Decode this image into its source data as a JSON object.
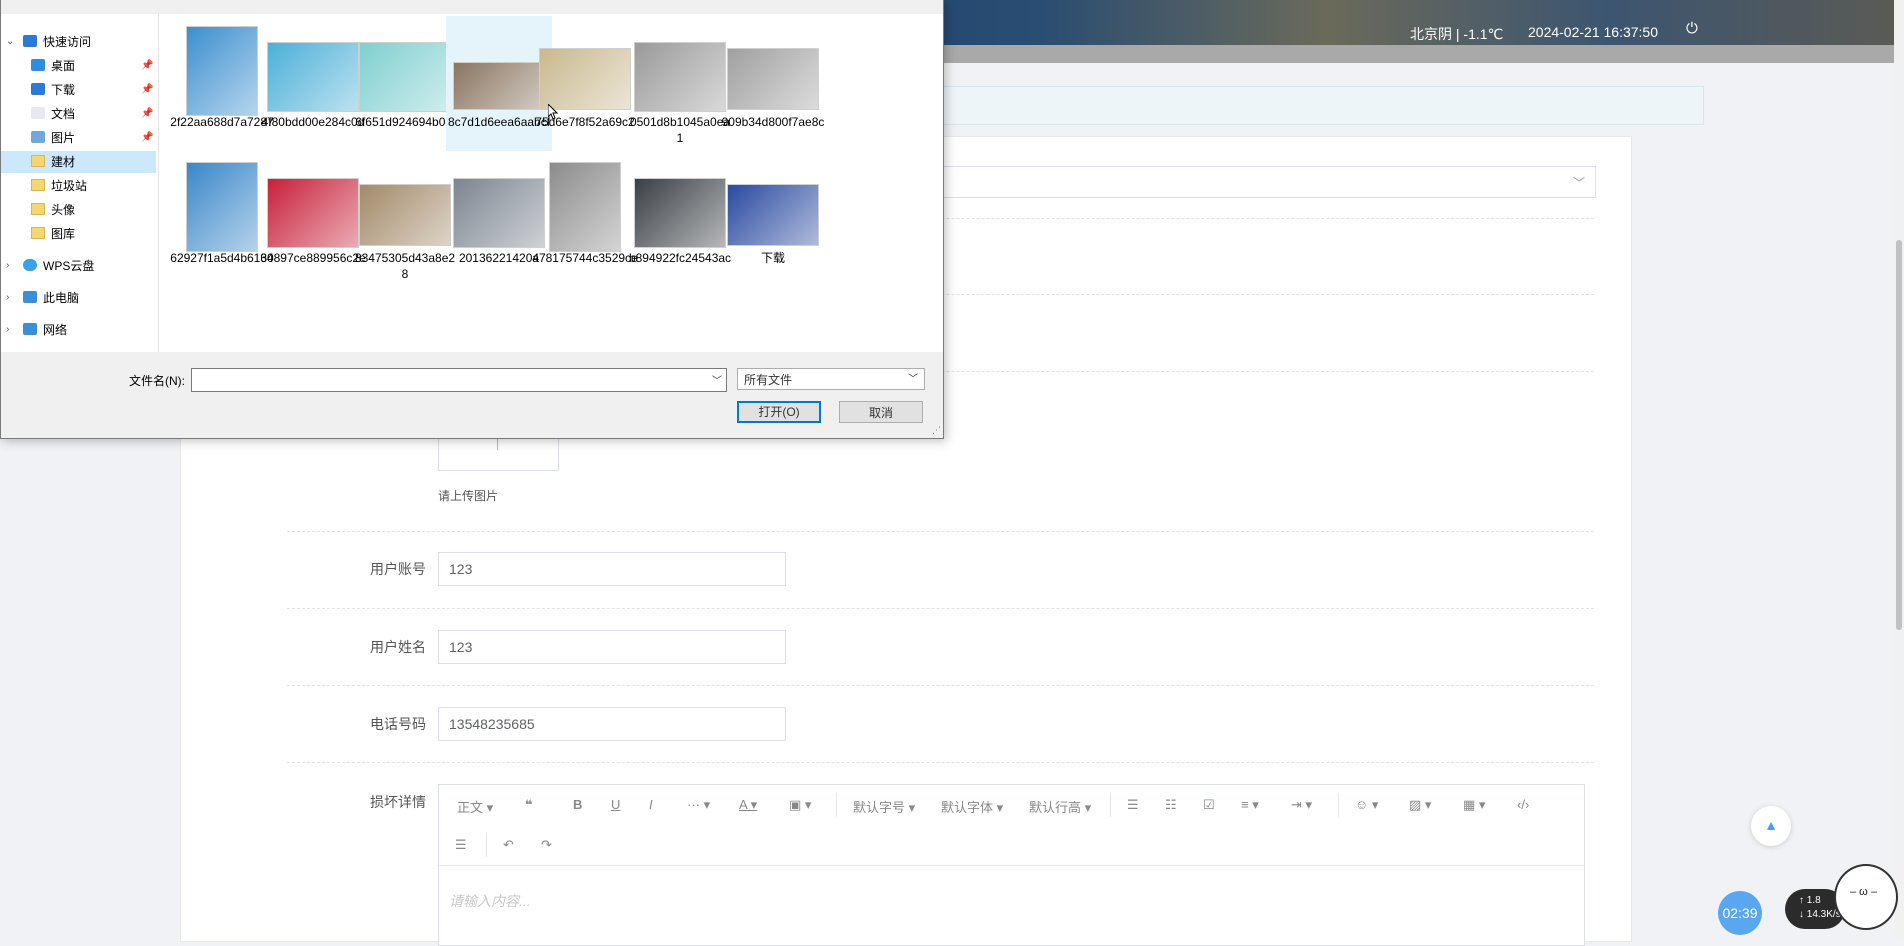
{
  "page": {
    "weather": "北京阴 | -1.1℃",
    "datetime": "2024-02-21   16:37:50",
    "upload_hint": "请上传图片",
    "fields": [
      {
        "label": "用户账号",
        "value": "123"
      },
      {
        "label": "用户姓名",
        "value": "123"
      },
      {
        "label": "电话号码",
        "value": "13548235685"
      }
    ],
    "detail_label": "损坏详情",
    "editor": {
      "toolbar": [
        "正文",
        "默认字号",
        "默认字体",
        "默认行高"
      ],
      "placeholder": "请输入内容..."
    },
    "timer": "02:39",
    "speed_up": "↑ 1.8",
    "speed_down": "↓ 14.3K/s"
  },
  "dialog": {
    "nav": [
      {
        "label": "快速访问",
        "icon": "star-icon"
      },
      {
        "label": "桌面",
        "icon": "desktop-icon",
        "pinned": true
      },
      {
        "label": "下载",
        "icon": "download-icon",
        "pinned": true
      },
      {
        "label": "文档",
        "icon": "document-icon",
        "pinned": true
      },
      {
        "label": "图片",
        "icon": "picture-icon",
        "pinned": true
      },
      {
        "label": "建材",
        "icon": "folder-icon",
        "selected": true
      },
      {
        "label": "垃圾站",
        "icon": "folder-icon"
      },
      {
        "label": "头像",
        "icon": "folder-icon"
      },
      {
        "label": "图库",
        "icon": "folder-icon"
      },
      {
        "label": "WPS云盘",
        "icon": "cloud-icon"
      },
      {
        "label": "此电脑",
        "icon": "computer-icon"
      },
      {
        "label": "网络",
        "icon": "network-icon"
      }
    ],
    "files": [
      {
        "name": "2f22aa688d7a7287",
        "color": "#3b8fd0"
      },
      {
        "name": "4f80bdd00e284c0d",
        "color": "#4cb0d8"
      },
      {
        "name": "6f651d924694b0cf",
        "color": "#7fcfd0"
      },
      {
        "name": "8c7d1d6eea6aabcf",
        "color": "#8a7560"
      },
      {
        "name": "75d6e7f8f52a69c2",
        "color": "#c9b98f"
      },
      {
        "name": "0501d8b1045a0ea1",
        "color": "#9a9a9a"
      },
      {
        "name": "909b34d800f7ae8c",
        "color": "#a0a0a0"
      },
      {
        "name": "62927f1a5d4b6130",
        "color": "#3a87c9"
      },
      {
        "name": "64897ce889956c2e",
        "color": "#c8203a"
      },
      {
        "name": "83475305d43a8e28",
        "color": "#a38a6a"
      },
      {
        "name": "201362214204",
        "color": "#7d8590"
      },
      {
        "name": "a78175744c3529ce",
        "color": "#8c8c8c"
      },
      {
        "name": "b894922fc24543ac",
        "color": "#3a3f44"
      },
      {
        "name": "下载",
        "color": "#2a4aa0"
      }
    ],
    "filename_label": "文件名(N):",
    "filename_value": "",
    "filter": "所有文件",
    "open_label": "打开(O)",
    "cancel_label": "取消"
  }
}
